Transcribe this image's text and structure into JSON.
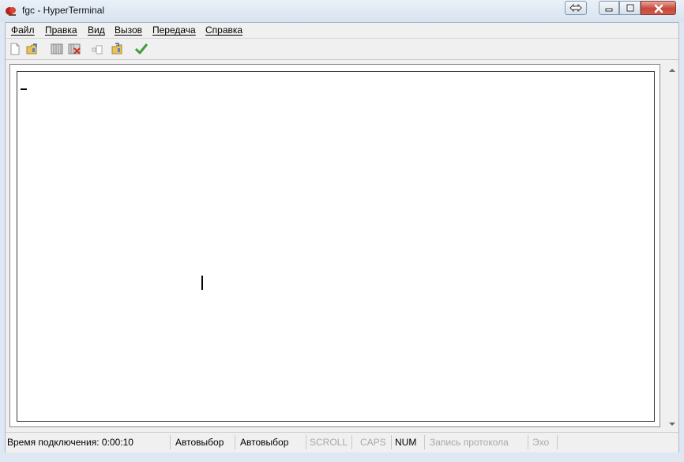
{
  "window": {
    "title": "fgc - HyperTerminal"
  },
  "menu": {
    "items": [
      "Файл",
      "Правка",
      "Вид",
      "Вызов",
      "Передача",
      "Справка"
    ]
  },
  "toolbar": {
    "icons": [
      "new-document-icon",
      "open-folder-icon",
      "call-properties-icon",
      "disconnect-icon",
      "send-file-icon",
      "receive-file-icon",
      "properties-check-icon"
    ]
  },
  "status": {
    "connection_time": "Время подключения: 0:00:10",
    "autodetect1": "Автовыбор",
    "autodetect2": "Автовыбор",
    "scroll": "SCROLL",
    "caps": "CAPS",
    "num": "NUM",
    "capture": "Запись протокола",
    "echo": "Эхо"
  },
  "colors": {
    "close_button": "#c8483a",
    "title_bg": "#dfe8f2"
  }
}
